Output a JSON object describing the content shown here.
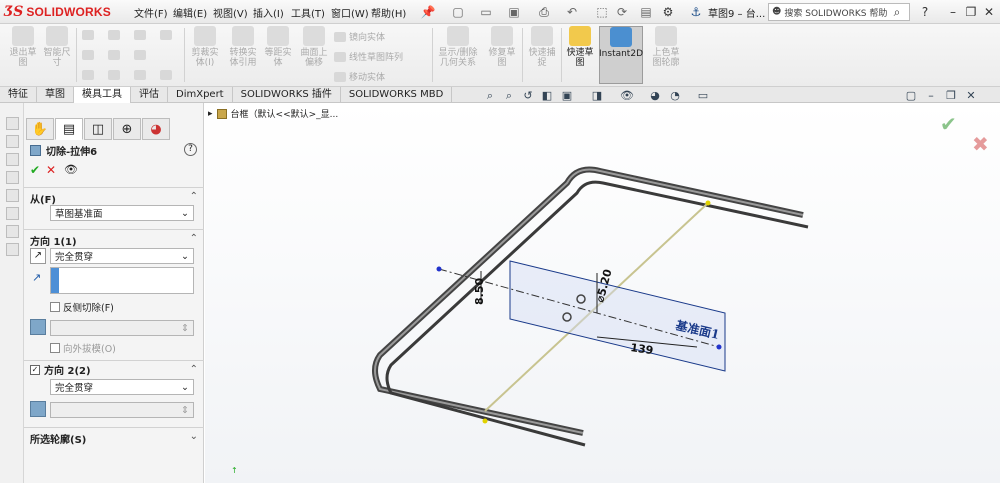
{
  "app": {
    "brand": "SOLIDWORKS",
    "brand_color": "#d22a2a"
  },
  "menus": [
    {
      "label": "文件(F)"
    },
    {
      "label": "编辑(E)"
    },
    {
      "label": "视图(V)"
    },
    {
      "label": "插入(I)"
    },
    {
      "label": "工具(T)"
    },
    {
      "label": "窗口(W)"
    },
    {
      "label": "帮助(H)"
    }
  ],
  "document": {
    "title": "草图9 – 台..."
  },
  "search": {
    "placeholder": "搜索 SOLIDWORKS 帮助"
  },
  "ribbon": {
    "smart_dim": "智能尺\n寸",
    "exit_sketch": "退出草\n图",
    "trim": "剪裁实\n体(I)",
    "convert": "转换实\n体引用",
    "offset": "等距实\n体",
    "surface_offset": "曲面上\n偏移",
    "mirror": "镜向实体",
    "linear_pattern": "线性草图阵列",
    "move": "移动实体",
    "display_relations": "显示/删除\n几何关系",
    "repair": "修复草\n图",
    "quick_snaps": "快速捕\n捉",
    "quick_sketch": "快速草\n图",
    "instant2d": "Instant2D",
    "shaded_sketch": "上色草\n图轮廓"
  },
  "tabs": [
    {
      "label": "特征",
      "active": false
    },
    {
      "label": "草图",
      "active": false
    },
    {
      "label": "模具工具",
      "active": true
    },
    {
      "label": "评估",
      "active": false
    },
    {
      "label": "DimXpert",
      "active": false
    },
    {
      "label": "SOLIDWORKS 插件",
      "active": false
    },
    {
      "label": "SOLIDWORKS MBD",
      "active": false
    }
  ],
  "property_manager": {
    "title": "切除-拉伸6",
    "from": {
      "label": "从(F)",
      "value": "草图基准面"
    },
    "direction1": {
      "label": "方向 1(1)",
      "end_condition": "完全贯穿",
      "flip_side": "反侧切除(F)",
      "draft_outward": "向外拔模(O)"
    },
    "direction2": {
      "label": "方向 2(2)",
      "checked": true,
      "end_condition": "完全贯穿"
    },
    "selected_contours": {
      "label": "所选轮廓(S)"
    }
  },
  "tree": {
    "root": "台框（默认<<默认>_显..."
  },
  "model": {
    "plane_label": "基准面1",
    "dims": [
      {
        "text": "8.50"
      },
      {
        "text": "⌀5.20"
      },
      {
        "text": "139"
      }
    ],
    "plane_color": "#1a3a8a",
    "frame_color": "#555555"
  }
}
